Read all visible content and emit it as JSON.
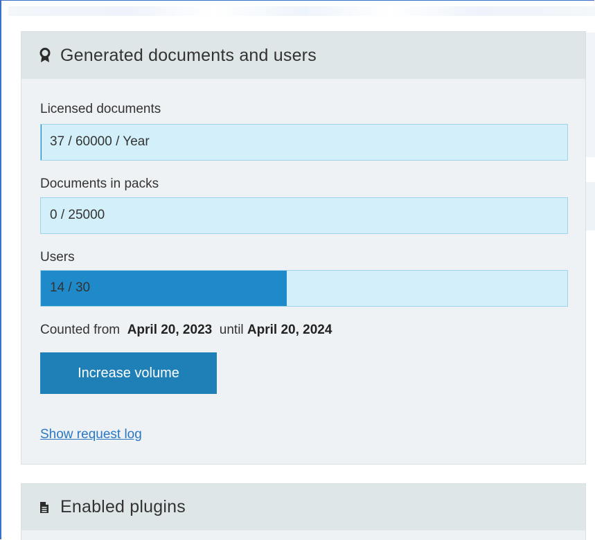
{
  "panel": {
    "title": "Generated documents and users",
    "icon": "award-ribbon-icon"
  },
  "fields": [
    {
      "label": "Licensed documents",
      "value": "37 / 60000 / Year",
      "progress_fraction": 0.0006
    },
    {
      "label": "Documents in packs",
      "value": "0 / 25000",
      "progress_fraction": 0
    },
    {
      "label": "Users",
      "value": "14 / 30",
      "progress_fraction": 0.4667
    }
  ],
  "period": {
    "prefix": "Counted from",
    "start": "April 20, 2023",
    "middle": "until",
    "end": "April 20, 2024"
  },
  "actions": {
    "increase_label": "Increase volume",
    "log_link": "Show request log"
  },
  "plugins_panel": {
    "title": "Enabled plugins",
    "icon": "document-icon"
  },
  "colors": {
    "bar_bg": "#d3f0fa",
    "bar_fill": "#1f8ac9",
    "button": "#1f80b8",
    "link": "#2a78c2"
  }
}
